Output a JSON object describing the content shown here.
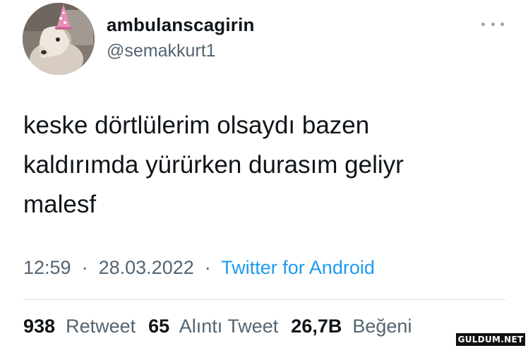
{
  "tweet": {
    "display_name": "ambulanscagirin",
    "handle": "@semakkurt1",
    "text_lines": [
      "keske dörtlülerim olsaydı bazen",
      "kaldırımda yürürken durasım geliyr",
      "malesf"
    ],
    "time": "12:59",
    "separator": "·",
    "date": "28.03.2022",
    "source": "Twitter for Android",
    "retweets_count": "938",
    "retweets_label": "Retweet",
    "quotes_count": "65",
    "quotes_label": "Alıntı Tweet",
    "likes_count": "26,7B",
    "likes_label": "Beğeni"
  },
  "watermark": "GULDUM.NET",
  "icons": {
    "avatar": "dog-with-party-hat-avatar",
    "more": "more-options-icon"
  },
  "colors": {
    "link": "#1d9bf0",
    "secondary_text": "#536471",
    "primary_text": "#0f1419"
  }
}
